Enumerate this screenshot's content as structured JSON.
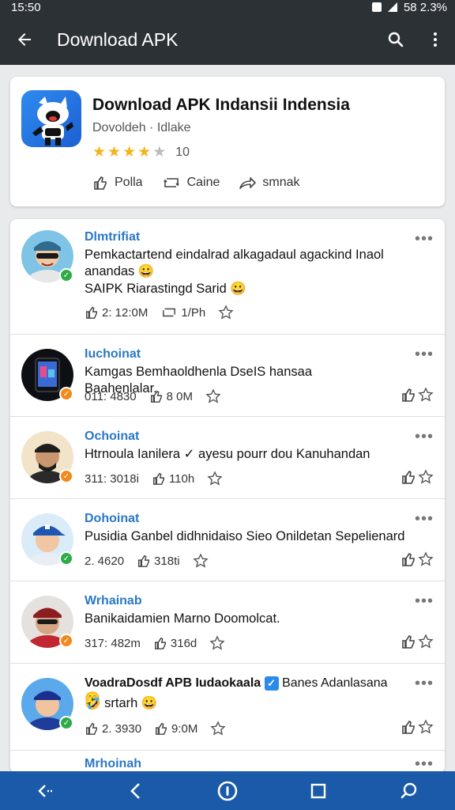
{
  "status": {
    "time": "15:50",
    "right_text": "58 2.3%"
  },
  "appbar": {
    "title": "Download APK",
    "back_icon": "arrow-left-icon",
    "search_icon": "search-icon",
    "menu_icon": "more-vert-icon"
  },
  "app": {
    "title": "Download APK Indansii Indensia",
    "subtitle": "Dovoldeh · Idlake",
    "rating_value": 4,
    "rating_count": "10",
    "actions": [
      {
        "label": "Polla",
        "icon": "like-icon"
      },
      {
        "label": "Caine",
        "icon": "repost-icon"
      },
      {
        "label": "smnak",
        "icon": "share-icon"
      }
    ]
  },
  "posts": [
    {
      "name": "Dlmtrifiat",
      "text": "Pemkactartend eindalrad alkagadaul agackind Inaol anandas 😀",
      "text2": "SAIPK Riarastingd Sarid 😀",
      "meta1": "2: 12:0M",
      "meta2": "1/Ph",
      "badge": "green",
      "avatar_bg": "#7fc4e6",
      "skin": "#f2c7a5",
      "hair": "#2f6b8e",
      "shirt": "#e7e7e7",
      "has_stars": false
    },
    {
      "name": "Iuchoinat",
      "text": "Kamgas Bemhaoldhenla DseIS hansaa Baahenlalar.",
      "text2": "",
      "meta1": "011: 4830",
      "meta2": "8 0M",
      "badge": "orange",
      "avatar_bg": "#0e0f14",
      "skin": "#3a6bd4",
      "hair": "#101217",
      "shirt": "#1f2430",
      "has_stars": true
    },
    {
      "name": "Ochoinat",
      "text": "Htrnoula Ianilera ✓ ayesu pourr dou Kanuhandan",
      "text2": "",
      "meta1": "311: 3018i",
      "meta2": "110h",
      "badge": "orange",
      "avatar_bg": "#f1e4c8",
      "skin": "#c9966f",
      "hair": "#1d1d1d",
      "shirt": "#2a2a2a",
      "has_stars": true
    },
    {
      "name": "Dohoinat",
      "text": "Pusidia Ganbel didhnidaiso Sieo Onildetan Sepelienard",
      "text2": "",
      "meta1": "2. 4620",
      "meta2": "318ti",
      "badge": "green",
      "avatar_bg": "#d9ecf8",
      "skin": "#f0c7a2",
      "hair": "#1f56b3",
      "shirt": "#e8eef3",
      "has_stars": true
    },
    {
      "name": "Wrhainab",
      "text": "Banikaidamien Marno Doomolcat.",
      "text2": "",
      "meta1": "317: 482m",
      "meta2": "316d",
      "badge": "orange",
      "avatar_bg": "#e5e1de",
      "skin": "#d6a584",
      "hair": "#8c1d23",
      "shirt": "#c22630",
      "has_stars": true
    },
    {
      "name": "VoadraDosdf APB Iudaokaala",
      "name_rest": "Banes Adanlasana 😀",
      "text": "🤣 srtarh 😀",
      "text2": "",
      "meta1": "2. 3930",
      "meta2": "9:0M",
      "badge": "green",
      "avatar_bg": "#5ba9ea",
      "skin": "#f1c49f",
      "hair": "#1b2f8f",
      "shirt": "#1f3c9a",
      "has_stars": true
    },
    {
      "name": "Mrhoinah",
      "text": "",
      "text2": "",
      "meta1": "",
      "meta2": "",
      "badge": "",
      "avatar_bg": "#ffffff",
      "skin": "#ffffff",
      "hair": "#ffffff",
      "shirt": "#ffffff",
      "has_stars": false
    }
  ],
  "navbar": {
    "icons": [
      "back-arrow-icon",
      "chevron-left-icon",
      "home-circle-icon",
      "recents-square-icon",
      "search-nav-icon"
    ]
  },
  "colors": {
    "appbar": "#2c3136",
    "navbar": "#1b5aa8",
    "name": "#2a78c5",
    "star": "#f5b41b"
  }
}
